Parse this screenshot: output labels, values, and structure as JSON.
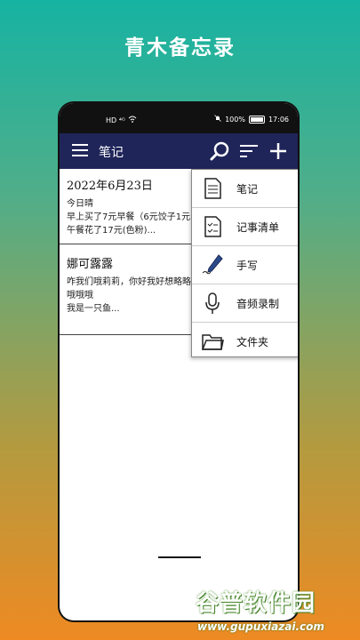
{
  "promo": {
    "title": "青木备忘录"
  },
  "status_bar": {
    "battery": "100%",
    "time": "17:06",
    "left_icons": "HD ⁴ᴳ"
  },
  "app_bar": {
    "title": "笔记"
  },
  "notes": [
    {
      "title": "2022年6月23日",
      "lines": [
        "今日晴",
        "早上买了7元早餐（6元饺子1元",
        "午餐花了17元(色粉)..."
      ]
    },
    {
      "title": "娜可露露",
      "lines": [
        "咋我们哦莉莉，你好我好想略略",
        "哦哦哦",
        "我是一只鱼..."
      ]
    }
  ],
  "menu": [
    {
      "label": "笔记",
      "icon": "document-icon"
    },
    {
      "label": "记事清单",
      "icon": "checklist-icon"
    },
    {
      "label": "手写",
      "icon": "pen-icon"
    },
    {
      "label": "音频录制",
      "icon": "microphone-icon"
    },
    {
      "label": "文件夹",
      "icon": "folder-icon"
    }
  ],
  "watermark": {
    "logo": "谷普软件园",
    "url": "www.gupuxiazai.com"
  },
  "colors": {
    "app_bar": "#1f2559",
    "gradient_top": "#16b3a2",
    "gradient_bottom": "#ee8a22"
  }
}
